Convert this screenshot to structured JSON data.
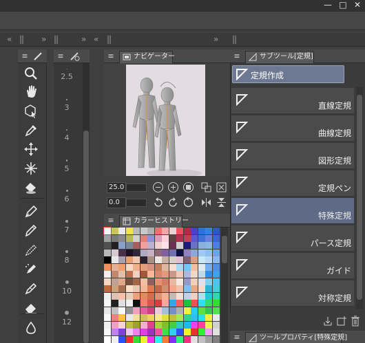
{
  "window": {
    "minimize_glyph": "—",
    "maximize_glyph": "□",
    "close_glyph": "✕"
  },
  "dock": {
    "collapse_left": "«",
    "expand_right": "»",
    "grip": "||"
  },
  "navigator": {
    "tab_label": "ナビゲーター",
    "zoom_value": "25.0",
    "rotate_value": "0.0"
  },
  "color_history": {
    "tab_label": "カラーヒストリー"
  },
  "sub_tool": {
    "tab_label": "サブツール[定規]",
    "group_label": "定規作成",
    "items": [
      {
        "label": "直線定規",
        "selected": false
      },
      {
        "label": "曲線定規",
        "selected": false
      },
      {
        "label": "図形定規",
        "selected": false
      },
      {
        "label": "定規ペン",
        "selected": false
      },
      {
        "label": "特殊定規",
        "selected": true
      },
      {
        "label": "パース定規",
        "selected": false
      },
      {
        "label": "ガイド",
        "selected": false
      },
      {
        "label": "対称定規",
        "selected": false
      }
    ]
  },
  "tool_property": {
    "tab_label": "ツールプロパティ[特殊定規]"
  },
  "brush_sizes": [
    "2.5",
    "3",
    "4",
    "5",
    "6",
    "7",
    "8",
    "10",
    "12"
  ],
  "tools": [
    "zoom-icon",
    "hand-icon",
    "operation-icon",
    "eyedropper-icon",
    "move-layer-icon",
    "auto-select-icon",
    "fill-icon",
    "pen-icon",
    "pencil-icon",
    "brush-icon",
    "airbrush-icon",
    "decoration-icon",
    "eraser-icon",
    "blend-icon"
  ],
  "colors": {
    "accent": "#5e6a86",
    "group_button": "#6d7892",
    "panel": "#3b3b3b"
  },
  "palette_colors": [
    [
      "#f5f5f5",
      "#c8c85a",
      "#e8e8e8",
      "#f2e34a",
      "#b8b8b8",
      "#c9c9c9",
      "#b0b0b0",
      "#f07070",
      "#f0a6a6",
      "#e8d2d2",
      "#f05060",
      "#b02a4a",
      "#4a3fd0",
      "#2f6fe0",
      "#3580e8",
      "#2a58c8"
    ],
    [
      "#a0a0a0",
      "#7a7a7a",
      "#8a8a8a",
      "#b8b858",
      "#cfcfcf",
      "#e08080",
      "#9090d8",
      "#d8a0b8",
      "#ffd0d8",
      "#604040",
      "#b03050",
      "#c04060",
      "#5a5ad0",
      "#4070d8",
      "#6a80e0",
      "#3a68d0"
    ],
    [
      "#505050",
      "#202020",
      "#8aa0c8",
      "#788898",
      "#a06060",
      "#f0a0a0",
      "#c0b0d0",
      "#f0d0d0",
      "#ffe0e8",
      "#6a3050",
      "#d0d0d0",
      "#1a1a7a",
      "#6870c8",
      "#8ab0e0",
      "#88b8e8",
      "#4a80e0"
    ],
    [
      "#b8b8b8",
      "#d8c8d0",
      "#483048",
      "#201020",
      "#302838",
      "#b0a8c0",
      "#c8b0c0",
      "#906878",
      "#8060a0",
      "#7070b0",
      "#101040",
      "#9080c0",
      "#8aa8d8",
      "#a0c8f0",
      "#90c0f0",
      "#70a0e8"
    ],
    [
      "#000000",
      "#e8e8e8",
      "#a8a0b0",
      "#e8a070",
      "#f0c8b0",
      "#2a2030",
      "#a89080",
      "#f0e8e0",
      "#c8b0a0",
      "#d8d0c8",
      "#e0c0d0",
      "#806070",
      "#d8a080",
      "#c8e8f8",
      "#b8d8f8",
      "#8ab8f0"
    ],
    [
      "#f09060",
      "#e8b090",
      "#f0a070",
      "#f8d8c0",
      "#f0b090",
      "#e0a080",
      "#d89080",
      "#c08060",
      "#e0b8a0",
      "#f8e0d0",
      "#a8d8f0",
      "#70c8f0",
      "#f0c0a0",
      "#e0e8f0",
      "#70b0f0",
      "#5090e0"
    ],
    [
      "#f0f0f0",
      "#c08870",
      "#e0c0a8",
      "#c07050",
      "#f0d0c0",
      "#a05838",
      "#f8b898",
      "#d88868",
      "#e89878",
      "#c89888",
      "#f0c8b8",
      "#b0b8e0",
      "#f0d8c8",
      "#c0d8e8",
      "#3090e8",
      "#40a0f0"
    ],
    [
      "#f8d8c0",
      "#c0a090",
      "#e0a888",
      "#785040",
      "#a06848",
      "#f0c0a0",
      "#906060",
      "#e89070",
      "#d08060",
      "#e8b8a0",
      "#f8e8e0",
      "#9898c8",
      "#f0d0b8",
      "#e0e0e8",
      "#80d0f0",
      "#50c0f0"
    ],
    [
      "#c06840",
      "#d0a078",
      "#a87050",
      "#f8e0c8",
      "#e8c8b0",
      "#f0b898",
      "#e07850",
      "#c06848",
      "#d09070",
      "#f0a888",
      "#f0c0a8",
      "#80c0e8",
      "#e8a888",
      "#f8d8c8",
      "#30b0e0",
      "#40d0e0"
    ],
    [
      "#f0f0f0",
      "#e0c0b0",
      "#f8c0a8",
      "#e8d0c0",
      "#f0a080",
      "#e88860",
      "#d07048",
      "#e09070",
      "#f8b090",
      "#c8b8b0",
      "#f0e0d8",
      "#c0d0e8",
      "#f0d0c0",
      "#b0e0f0",
      "#20c8d8",
      "#30d8b0"
    ],
    [
      "#f8f8f8",
      "#202020",
      "#e0e0e0",
      "#f0f0f0",
      "#101010",
      "#f08070",
      "#e05050",
      "#d04040",
      "#f8a8a0",
      "#30a8e8",
      "#f06060",
      "#20c040",
      "#f05050",
      "#30e0f0",
      "#30e060",
      "#30e030"
    ],
    [
      "#e8e8e8",
      "#c0c0c0",
      "#f8f8f8",
      "#909090",
      "#f0a0c0",
      "#e060a0",
      "#d04080",
      "#f0c8d8",
      "#a0c0e0",
      "#7090c8",
      "#b0b0b0",
      "#f0f040",
      "#20d0f0",
      "#60e040",
      "#30c850",
      "#50e050"
    ],
    [
      "#f8f8f8",
      "#f08080",
      "#ffc040",
      "#e8e8e8",
      "#f0e0a0",
      "#d0c060",
      "#f0d060",
      "#f8e890",
      "#e0e040",
      "#c0c040",
      "#a8e850",
      "#30d0a0",
      "#30c0f0",
      "#30e0e0",
      "#f0f040",
      "#e8e8e8"
    ],
    [
      "#f0f0f0",
      "#f0a0c8",
      "#f8d0e0",
      "#c0c040",
      "#a0a030",
      "#f0b0d0",
      "#e04090",
      "#b0d040",
      "#80c030",
      "#40d040",
      "#30c8c0",
      "#20b8f0",
      "#f040f0",
      "#ff40a0",
      "#f0f060",
      "#d0d0d0"
    ],
    [
      "#f8f8f8",
      "#c080f0",
      "#8040e0",
      "#f0c8f0",
      "#f080f0",
      "#e040e0",
      "#a030c0",
      "#f050a0",
      "#40e040",
      "#30d0f0",
      "#3050f0",
      "#f0f030",
      "#f03030",
      "#30f030",
      "#f0a0f0",
      "#e0e0e0"
    ],
    [
      "#ffffff",
      "#f0f0f0",
      "#3050f0",
      "#f03030",
      "#30e030",
      "#f0f030",
      "#f030f0",
      "#30f0f0",
      "#f08030",
      "#8030f0",
      "#30f080",
      "#f03080",
      "#e0e0e0",
      "#c0c0c0",
      "#a0a0a0",
      "#808080"
    ]
  ]
}
